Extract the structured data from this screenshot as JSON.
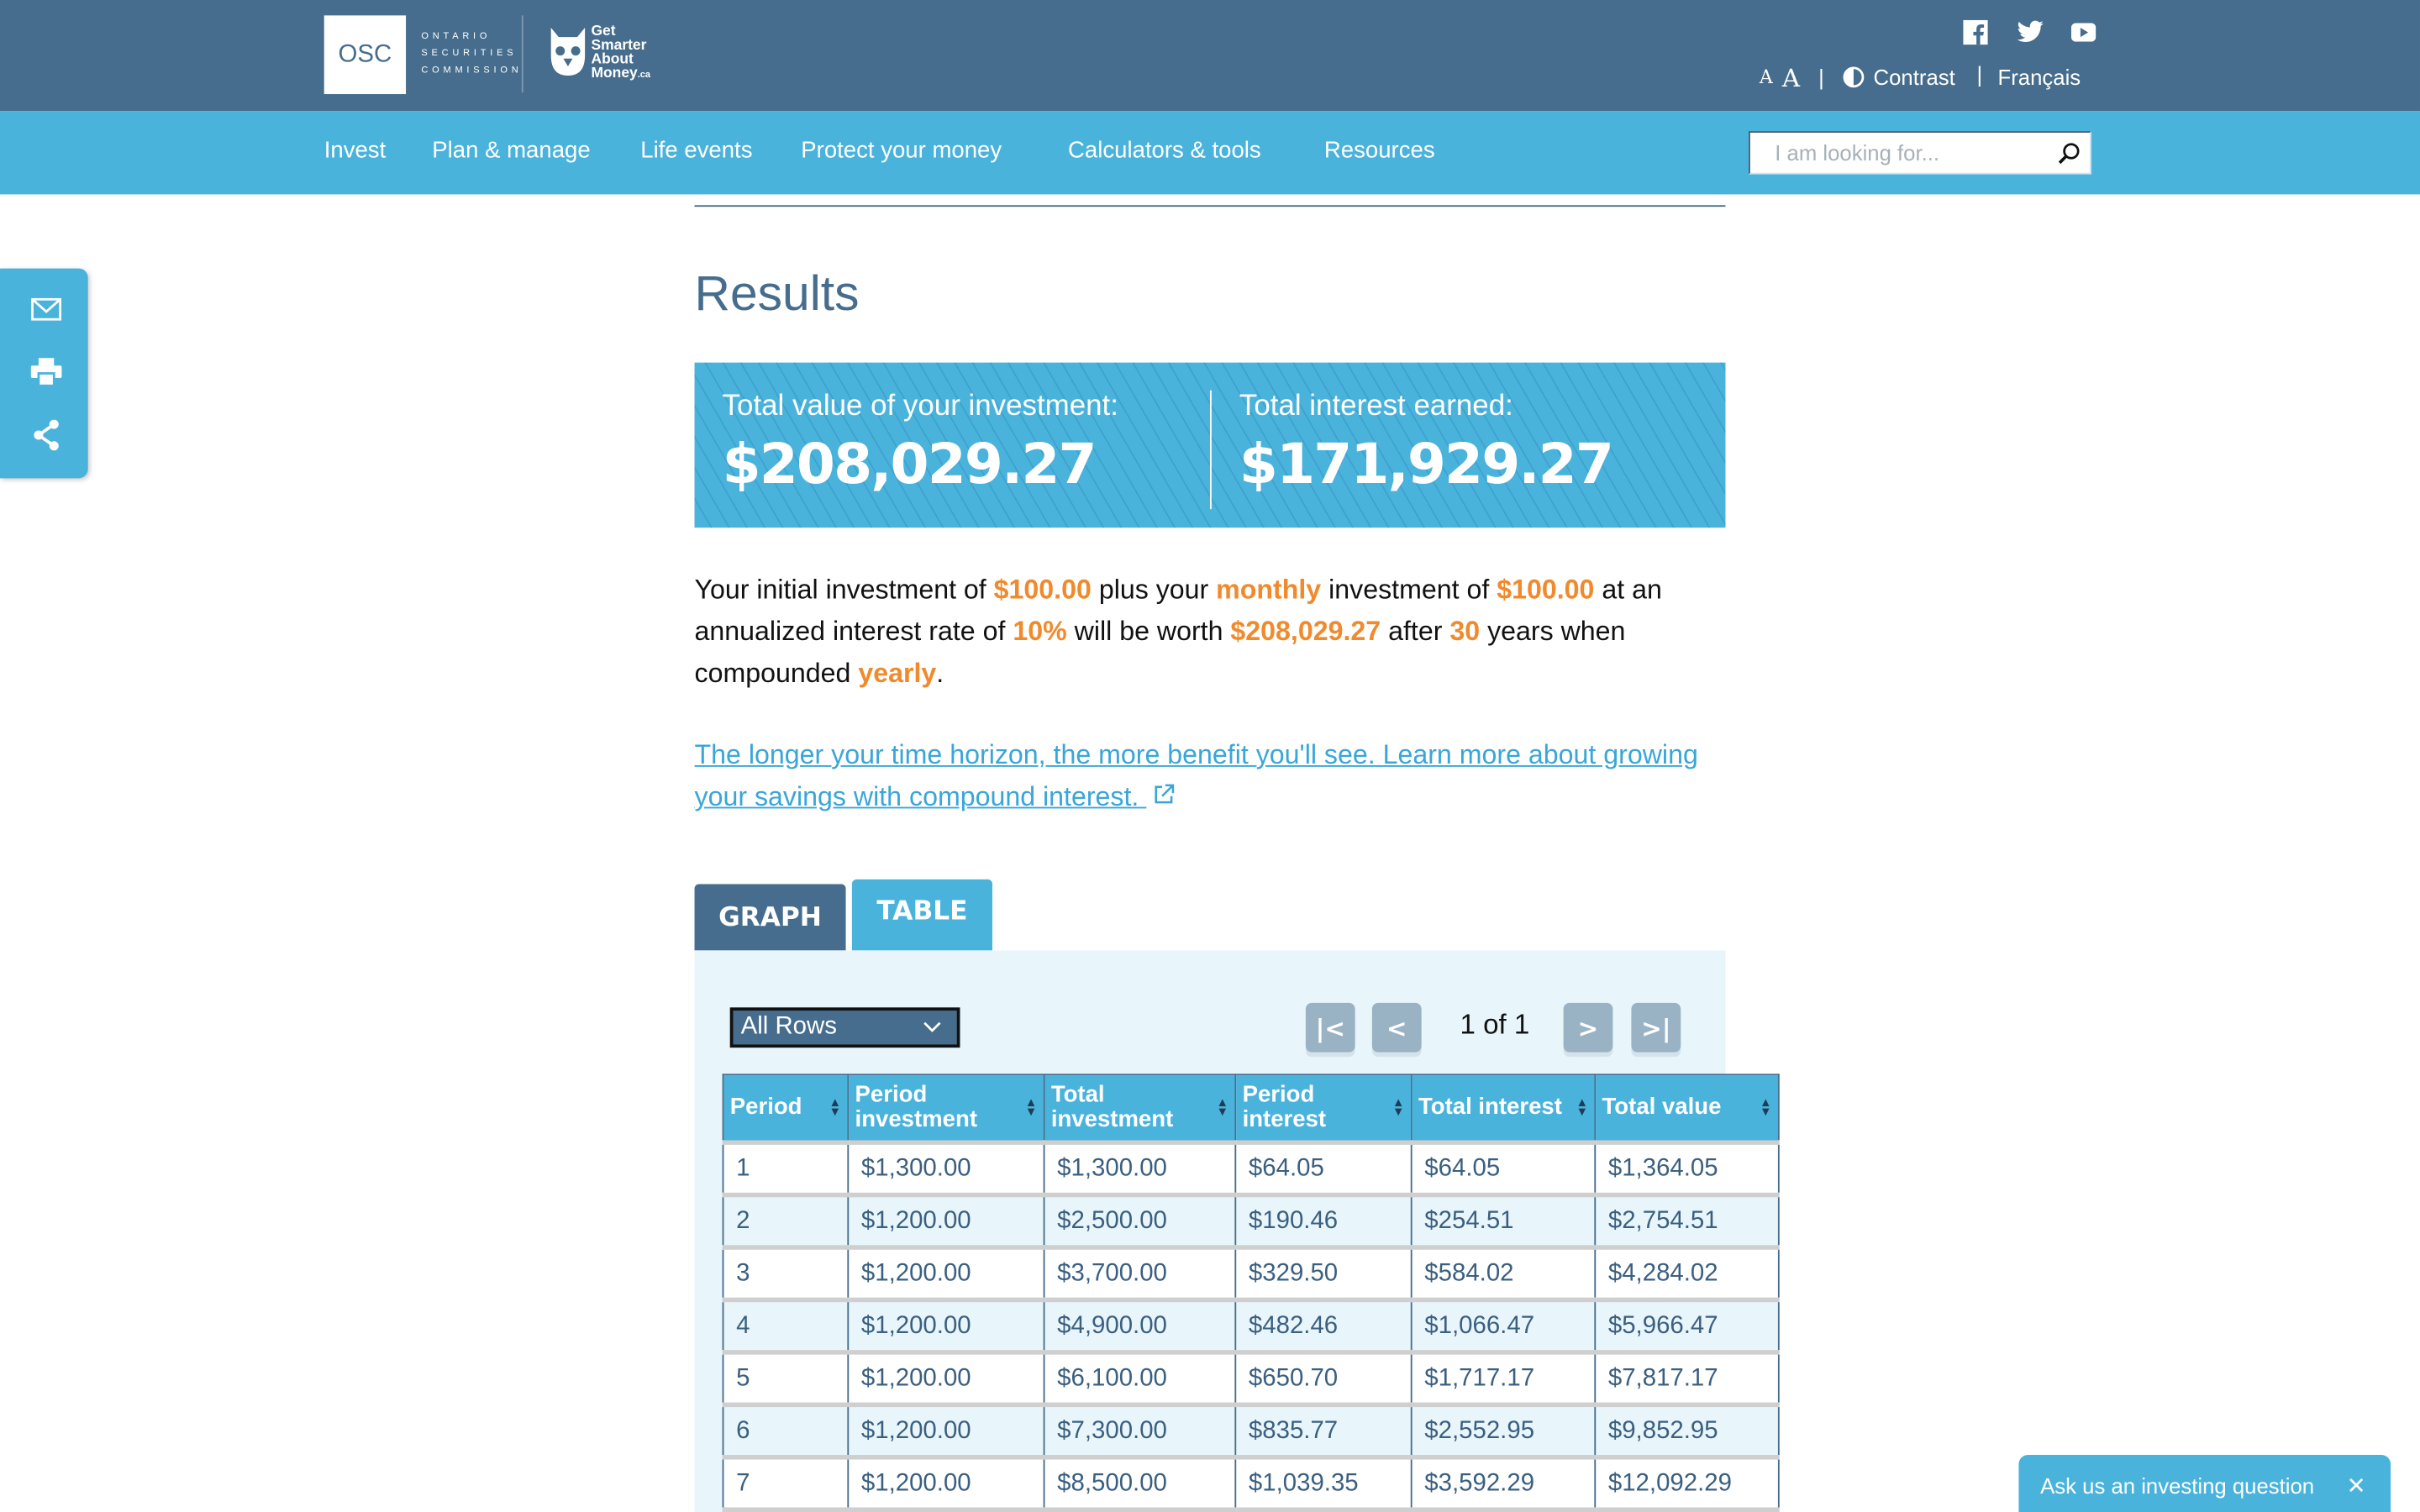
{
  "header": {
    "osc_logo": "OSC",
    "osc_name": [
      "ONTARIO",
      "SECURITIES",
      "COMMISSION"
    ],
    "gsam_logo": [
      "Get",
      "Smarter",
      "About",
      "Money",
      ".ca"
    ],
    "social": [
      "facebook-icon",
      "twitter-icon",
      "youtube-icon"
    ],
    "font_small": "A",
    "font_large": "A",
    "contrast": "Contrast",
    "language": "Français"
  },
  "nav": {
    "items": [
      "Invest",
      "Plan & manage",
      "Life events",
      "Protect your money",
      "Calculators & tools",
      "Resources"
    ],
    "search_placeholder": "I am looking for..."
  },
  "share": [
    "email-icon",
    "print-icon",
    "share-icon"
  ],
  "results": {
    "title": "Results",
    "total_value_label": "Total value of your investment:",
    "total_value": "$208,029.27",
    "total_interest_label": "Total interest earned:",
    "total_interest": "$171,929.27",
    "desc": {
      "t1": "Your initial investment of ",
      "v1": "$100.00",
      "t2": " plus your ",
      "v2": "monthly",
      "t3": " investment of ",
      "v3": "$100.00",
      "t4": " at an annualized interest rate of ",
      "v4": "10%",
      "t5": " will be worth ",
      "v5": "$208,029.27",
      "t6": " after ",
      "v6": "30",
      "t7": " years when compounded ",
      "v7": "yearly",
      "t8": "."
    },
    "link": "The longer your time horizon, the more benefit you'll see. Learn more about growing your savings with compound interest."
  },
  "tabs": {
    "graph": "GRAPH",
    "table": "TABLE",
    "active": "table"
  },
  "table_controls": {
    "rows_select": "All Rows",
    "page_text": "1 of 1",
    "first": "|<",
    "prev": "<",
    "next": ">",
    "last": ">|"
  },
  "table": {
    "headers": [
      "Period",
      "Period investment",
      "Total investment",
      "Period interest",
      "Total interest",
      "Total value"
    ],
    "rows": [
      [
        "1",
        "$1,300.00",
        "$1,300.00",
        "$64.05",
        "$64.05",
        "$1,364.05"
      ],
      [
        "2",
        "$1,200.00",
        "$2,500.00",
        "$190.46",
        "$254.51",
        "$2,754.51"
      ],
      [
        "3",
        "$1,200.00",
        "$3,700.00",
        "$329.50",
        "$584.02",
        "$4,284.02"
      ],
      [
        "4",
        "$1,200.00",
        "$4,900.00",
        "$482.46",
        "$1,066.47",
        "$5,966.47"
      ],
      [
        "5",
        "$1,200.00",
        "$6,100.00",
        "$650.70",
        "$1,717.17",
        "$7,817.17"
      ],
      [
        "6",
        "$1,200.00",
        "$7,300.00",
        "$835.77",
        "$2,552.95",
        "$9,852.95"
      ],
      [
        "7",
        "$1,200.00",
        "$8,500.00",
        "$1,039.35",
        "$3,592.29",
        "$12,092.29"
      ],
      [
        "",
        "",
        "",
        "",
        "",
        ""
      ]
    ]
  },
  "chat": {
    "label": "Ask us an investing question",
    "close": "✕"
  },
  "colors": {
    "header": "#466d8d",
    "nav": "#4ab3dc",
    "highlight": "#f08a2c",
    "link": "#3aa6d8"
  }
}
